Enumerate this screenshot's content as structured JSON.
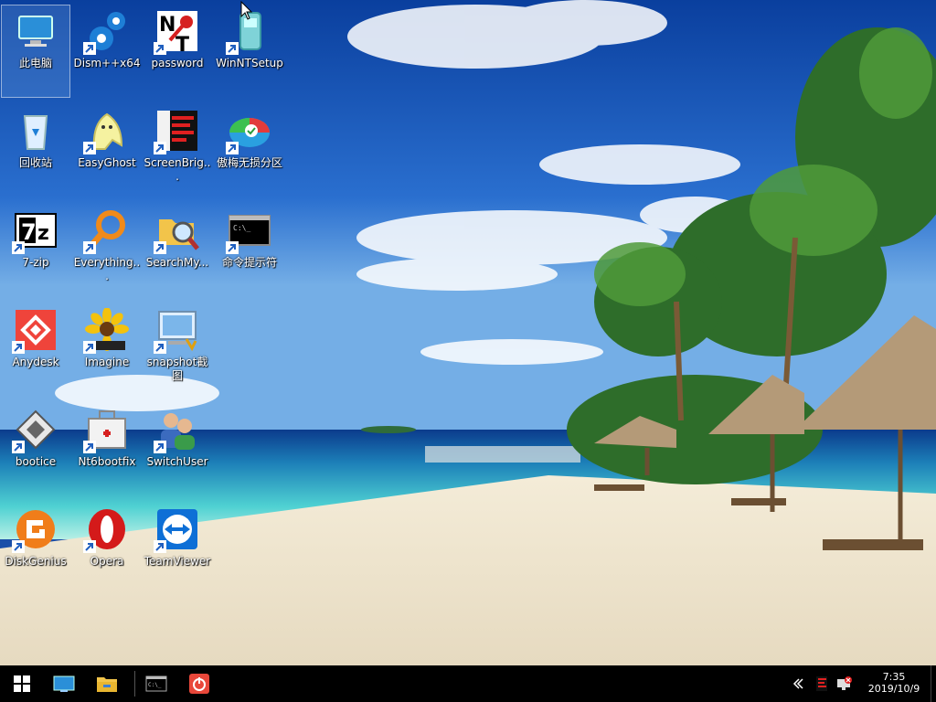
{
  "desktop": {
    "icons": [
      {
        "label": "此电脑",
        "icon": "computer-icon"
      },
      {
        "label": "Dism++x64",
        "icon": "gears-icon"
      },
      {
        "label": "password",
        "icon": "nt-password-icon"
      },
      {
        "label": "WinNTSetup",
        "icon": "winntsetup-icon"
      },
      {
        "label": "回收站",
        "icon": "recycle-bin-icon"
      },
      {
        "label": "EasyGhost",
        "icon": "ghost-icon"
      },
      {
        "label": "ScreenBrig...",
        "icon": "screenbright-icon"
      },
      {
        "label": "傲梅无损分区",
        "icon": "partition-icon"
      },
      {
        "label": "7-zip",
        "icon": "7zip-icon"
      },
      {
        "label": "Everything...",
        "icon": "everything-search-icon"
      },
      {
        "label": "SearchMy...",
        "icon": "folder-magnifier-icon"
      },
      {
        "label": "命令提示符",
        "icon": "cmd-icon"
      },
      {
        "label": "Anydesk",
        "icon": "anydesk-icon"
      },
      {
        "label": "Imagine",
        "icon": "imagine-flower-icon"
      },
      {
        "label": "snapshot截图",
        "icon": "snapshot-icon"
      },
      {
        "label": "bootice",
        "icon": "bootice-icon"
      },
      {
        "label": "Nt6bootfix",
        "icon": "toolbox-icon"
      },
      {
        "label": "SwitchUser",
        "icon": "users-icon"
      },
      {
        "label": "DiskGenius",
        "icon": "diskgenius-icon"
      },
      {
        "label": "Opera",
        "icon": "opera-icon"
      },
      {
        "label": "TeamViewer",
        "icon": "teamviewer-icon"
      }
    ]
  },
  "taskbar": {
    "start": "windows-start-icon",
    "pinned": [
      "desktop-icon",
      "file-explorer-icon",
      "cmd-icon",
      "power-icon"
    ],
    "tray_icons": [
      "chevron-left-icon",
      "tray-app-icon",
      "tray-network-icon"
    ],
    "time": "7:35",
    "date": "2019/10/9"
  }
}
